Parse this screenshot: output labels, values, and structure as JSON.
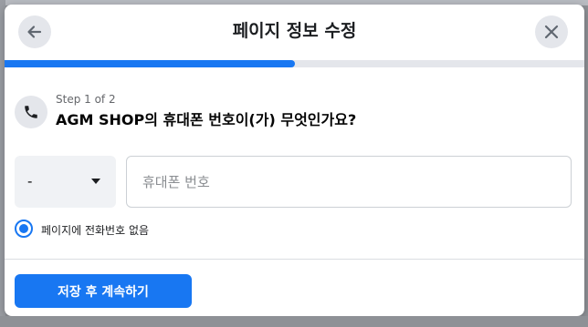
{
  "dialog": {
    "title": "페이지 정보 수정",
    "progress_fraction": 0.5
  },
  "step": {
    "label": "Step 1 of 2",
    "question": "AGM SHOP의 휴대폰 번호이(가) 무엇인가요?"
  },
  "form": {
    "country_code_value": "-",
    "phone_placeholder": "휴대폰 번호",
    "phone_value": "",
    "no_phone_label": "페이지에 전화번호 없음",
    "no_phone_checked": true
  },
  "footer": {
    "save_label": "저장 후 계속하기"
  },
  "colors": {
    "accent": "#1877f2",
    "icon_bg": "#e4e6eb"
  },
  "icons": {
    "back": "arrow-left-icon",
    "close": "close-icon",
    "phone": "phone-icon",
    "caret": "caret-down-icon"
  }
}
